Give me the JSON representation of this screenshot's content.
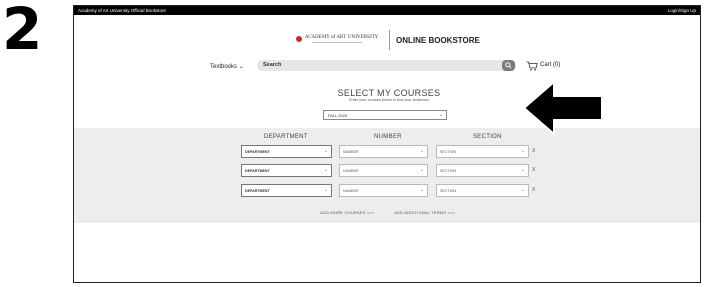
{
  "step_number": "2",
  "topbar": {
    "left": "Academy of Art University Official Bookstore",
    "right": "Login/Sign Up"
  },
  "brand": {
    "university": "ACADEMY of ART UNIVERSITY",
    "store": "ONLINE BOOKSTORE",
    "accent_color": "#d42a2a"
  },
  "nav": {
    "textbooks_label": "Textbooks",
    "search_placeholder": "Search",
    "cart_label": "Cart (0)"
  },
  "course_select": {
    "title": "SELECT MY COURSES",
    "subtitle": "Enter your courses below to find your textbooks",
    "term_value": "FALL 2020"
  },
  "columns": {
    "department": "DEPARTMENT",
    "number": "NUMBER",
    "section": "SECTION"
  },
  "rows": [
    {
      "department": "DEPARTMENT",
      "number": "NUMBER",
      "section": "SECTION",
      "remove": "X"
    },
    {
      "department": "DEPARTMENT",
      "number": "NUMBER",
      "section": "SECTION",
      "remove": "X"
    },
    {
      "department": "DEPARTMENT",
      "number": "NUMBER",
      "section": "SECTION",
      "remove": "X"
    }
  ],
  "links": {
    "add_courses": "ADD MORE COURSES >>>",
    "add_terms": "ADD ADDITIONAL TERMS >>>"
  }
}
